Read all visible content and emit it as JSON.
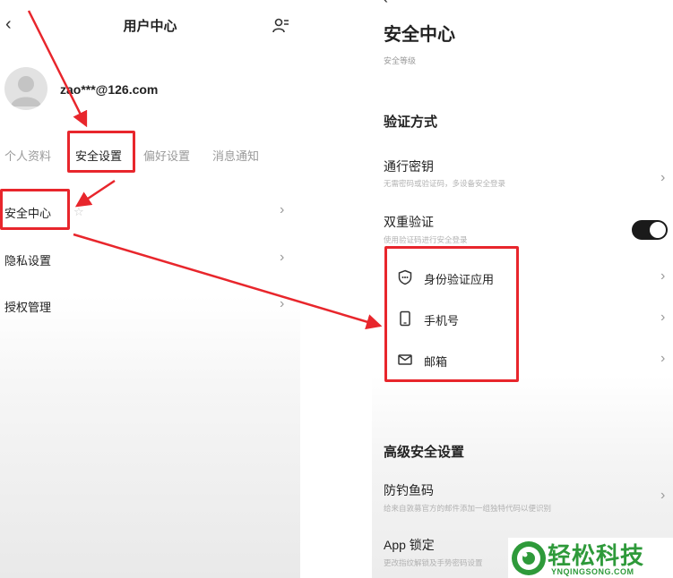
{
  "colors": {
    "annotation_red": "#e8262c",
    "toggle_on": "#1a1a1a",
    "watermark_green": "#2e9a3a"
  },
  "user_center": {
    "title": "用户中心",
    "username": "zao***@126.com",
    "tabs": [
      "个人资料",
      "安全设置",
      "偏好设置",
      "消息通知"
    ],
    "rows": [
      "安全中心",
      "隐私设置",
      "授权管理"
    ]
  },
  "security_center": {
    "title": "安全中心",
    "level_label": "安全等级",
    "verify_section": "验证方式",
    "passkey": {
      "title": "通行密钥",
      "desc": "无需密码或验证码，多设备安全登录"
    },
    "two_factor": {
      "title": "双重验证",
      "desc": "使用验证码进行安全登录",
      "enabled": true
    },
    "methods": [
      "身份验证应用",
      "手机号",
      "邮箱"
    ],
    "advanced_section": "高级安全设置",
    "anti_phishing": {
      "title": "防钓鱼码",
      "desc": "给来自敦募官方的邮件添加一组独特代码以便识别"
    },
    "app_lock": {
      "title": "App 锁定",
      "desc": "更改指纹解锁及手势密码设置"
    }
  },
  "watermark": {
    "brand": "轻松科技",
    "domain": "YNQINGSONG.COM"
  }
}
